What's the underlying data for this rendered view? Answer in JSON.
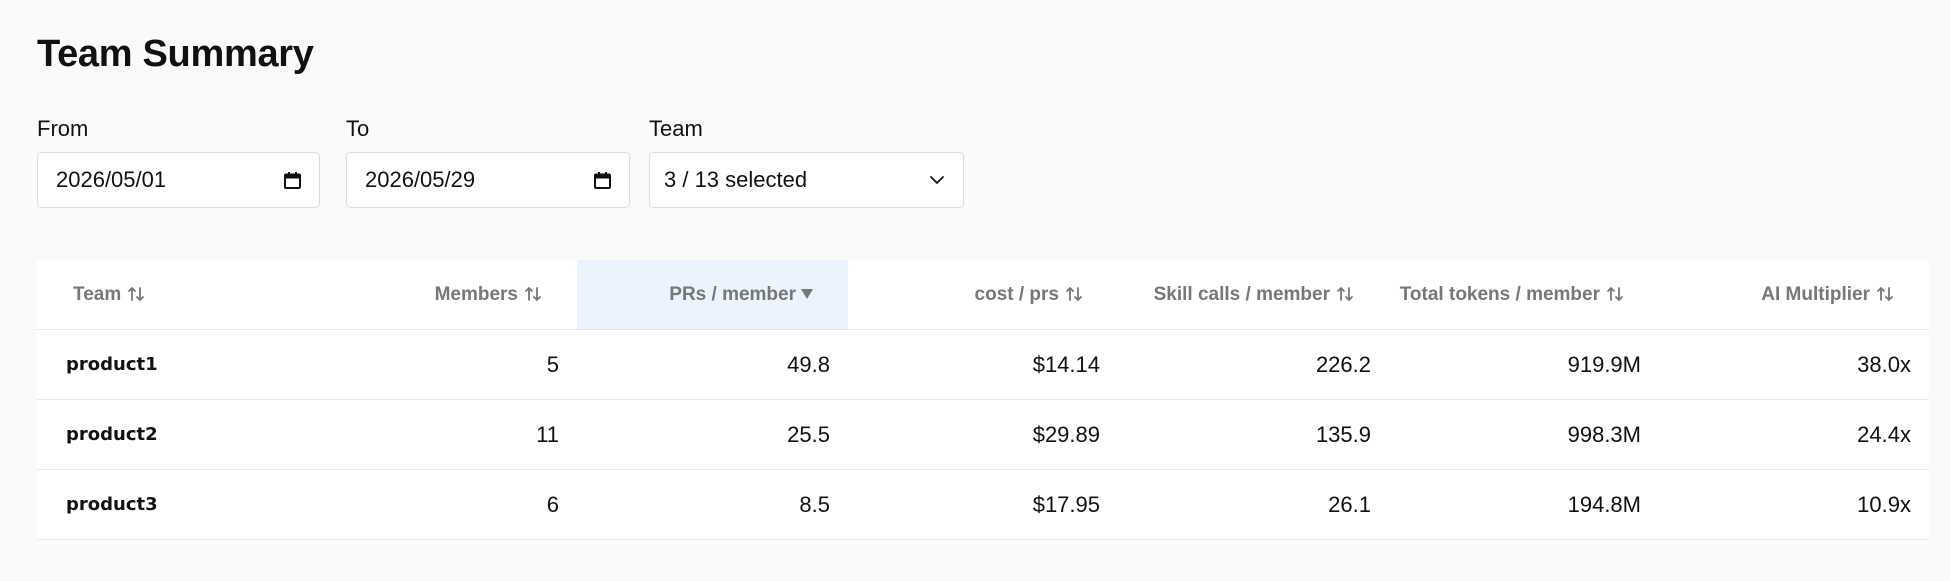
{
  "page": {
    "title": "Team Summary"
  },
  "filters": {
    "from": {
      "label": "From",
      "value": "2026/05/01",
      "icon": "calendar-icon"
    },
    "to": {
      "label": "To",
      "value": "2026/05/29",
      "icon": "calendar-icon"
    },
    "team": {
      "label": "Team",
      "value": "3 / 13 selected",
      "icon": "chevron-down-icon"
    }
  },
  "table": {
    "sorted_column": "PRs / member",
    "sort_direction": "descending",
    "columns": [
      {
        "label": "Team",
        "icon": "sort-icon"
      },
      {
        "label": "Members",
        "icon": "sort-icon"
      },
      {
        "label": "PRs / member",
        "icon": "sort-desc-icon"
      },
      {
        "label": "cost / prs",
        "icon": "sort-icon"
      },
      {
        "label": "Skill calls / member",
        "icon": "sort-icon"
      },
      {
        "label": "Total tokens / member",
        "icon": "sort-icon"
      },
      {
        "label": "AI Multiplier",
        "icon": "sort-icon"
      }
    ],
    "rows": [
      [
        "product1",
        "5",
        "49.8",
        "$14.14",
        "226.2",
        "919.9M",
        "38.0x"
      ],
      [
        "product2",
        "11",
        "25.5",
        "$29.89",
        "135.9",
        "998.3M",
        "24.4x"
      ],
      [
        "product3",
        "6",
        "8.5",
        "$17.95",
        "26.1",
        "194.8M",
        "10.9x"
      ]
    ]
  },
  "colors": {
    "background": "#fafafa",
    "sorted_header_bg": "#eaf3fe",
    "header_text": "#777777",
    "text": "#111111"
  }
}
